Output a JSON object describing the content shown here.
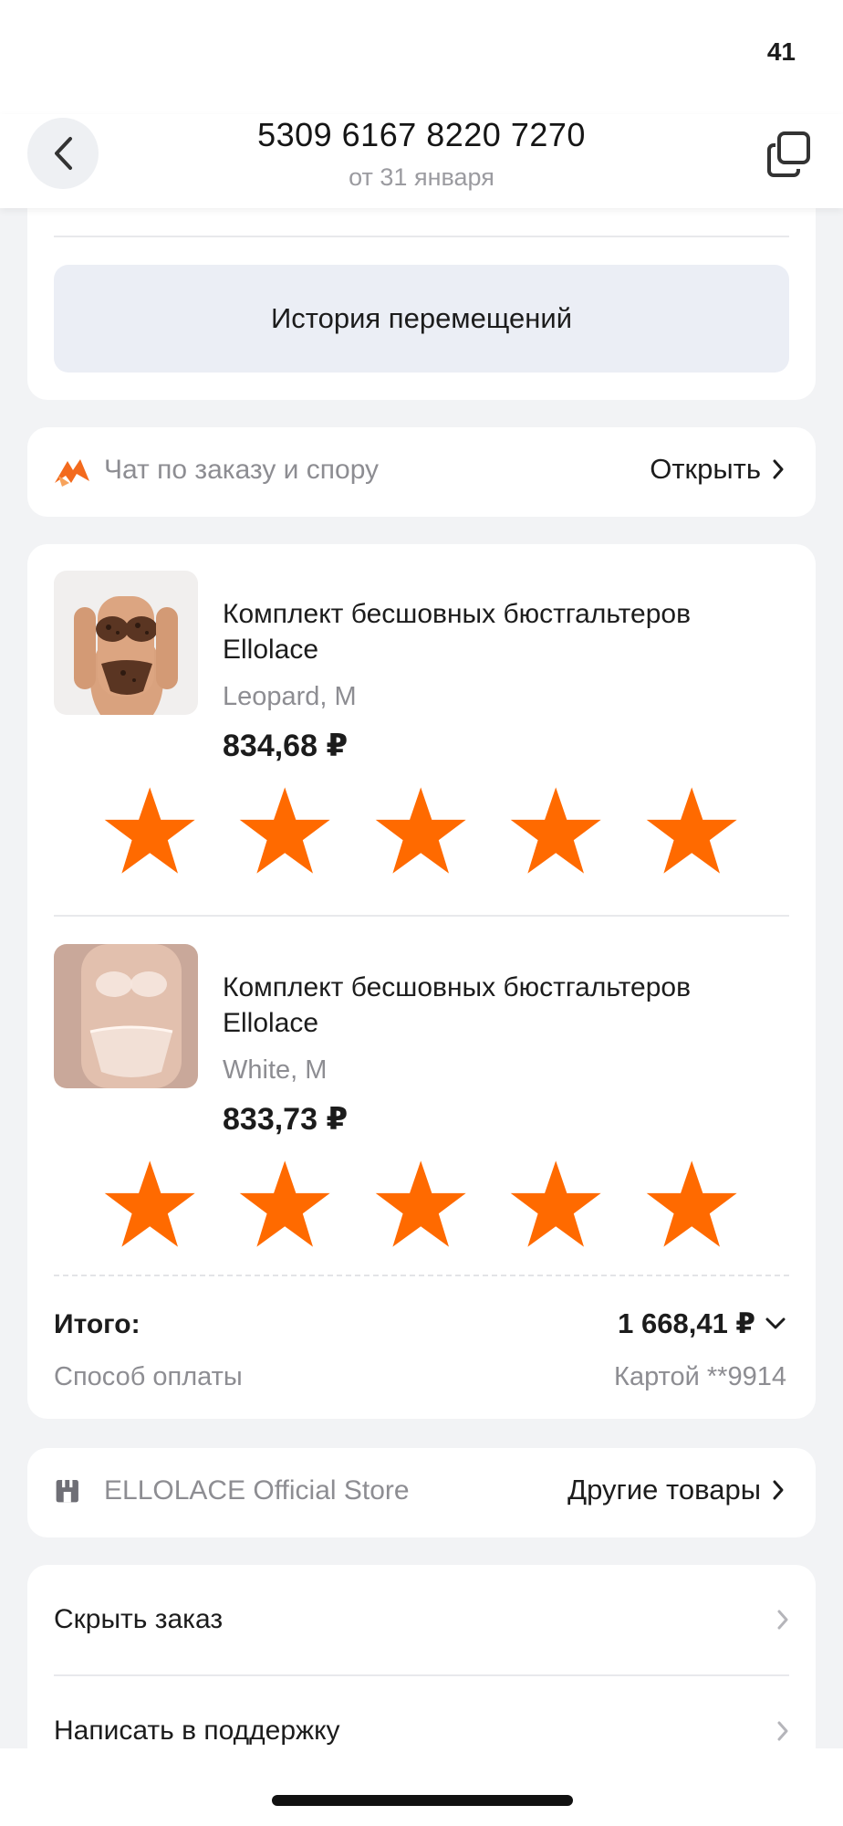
{
  "status": {
    "battery": "41"
  },
  "header": {
    "title": "5309 6167 8220 7270",
    "subtitle": "от 31 января"
  },
  "history": {
    "button_label": "История перемещений"
  },
  "chat": {
    "label": "Чат по заказу и спору",
    "action": "Открыть"
  },
  "items": [
    {
      "name": "Комплект бесшовных бюстгальтеров Ellolace",
      "variant": "Leopard, M",
      "price": "834,68 ₽",
      "rating": 5,
      "rating_max": 5
    },
    {
      "name": "Комплект бесшовных бюстгальтеров Ellolace",
      "variant": "White, M",
      "price": "833,73 ₽",
      "rating": 5,
      "rating_max": 5
    }
  ],
  "summary": {
    "total_label": "Итого:",
    "total_value": "1 668,41 ₽",
    "payment_label": "Способ оплаты",
    "payment_value": "Картой **9914"
  },
  "store": {
    "name": "ELLOLACE Official Store",
    "action": "Другие товары"
  },
  "actions": {
    "hide_order": "Скрыть заказ",
    "contact_support": "Написать в поддержку"
  },
  "colors": {
    "accent_star": "#ff6a00",
    "chat_icon": "#f36a1d",
    "battery_badge": "#ffd500"
  }
}
